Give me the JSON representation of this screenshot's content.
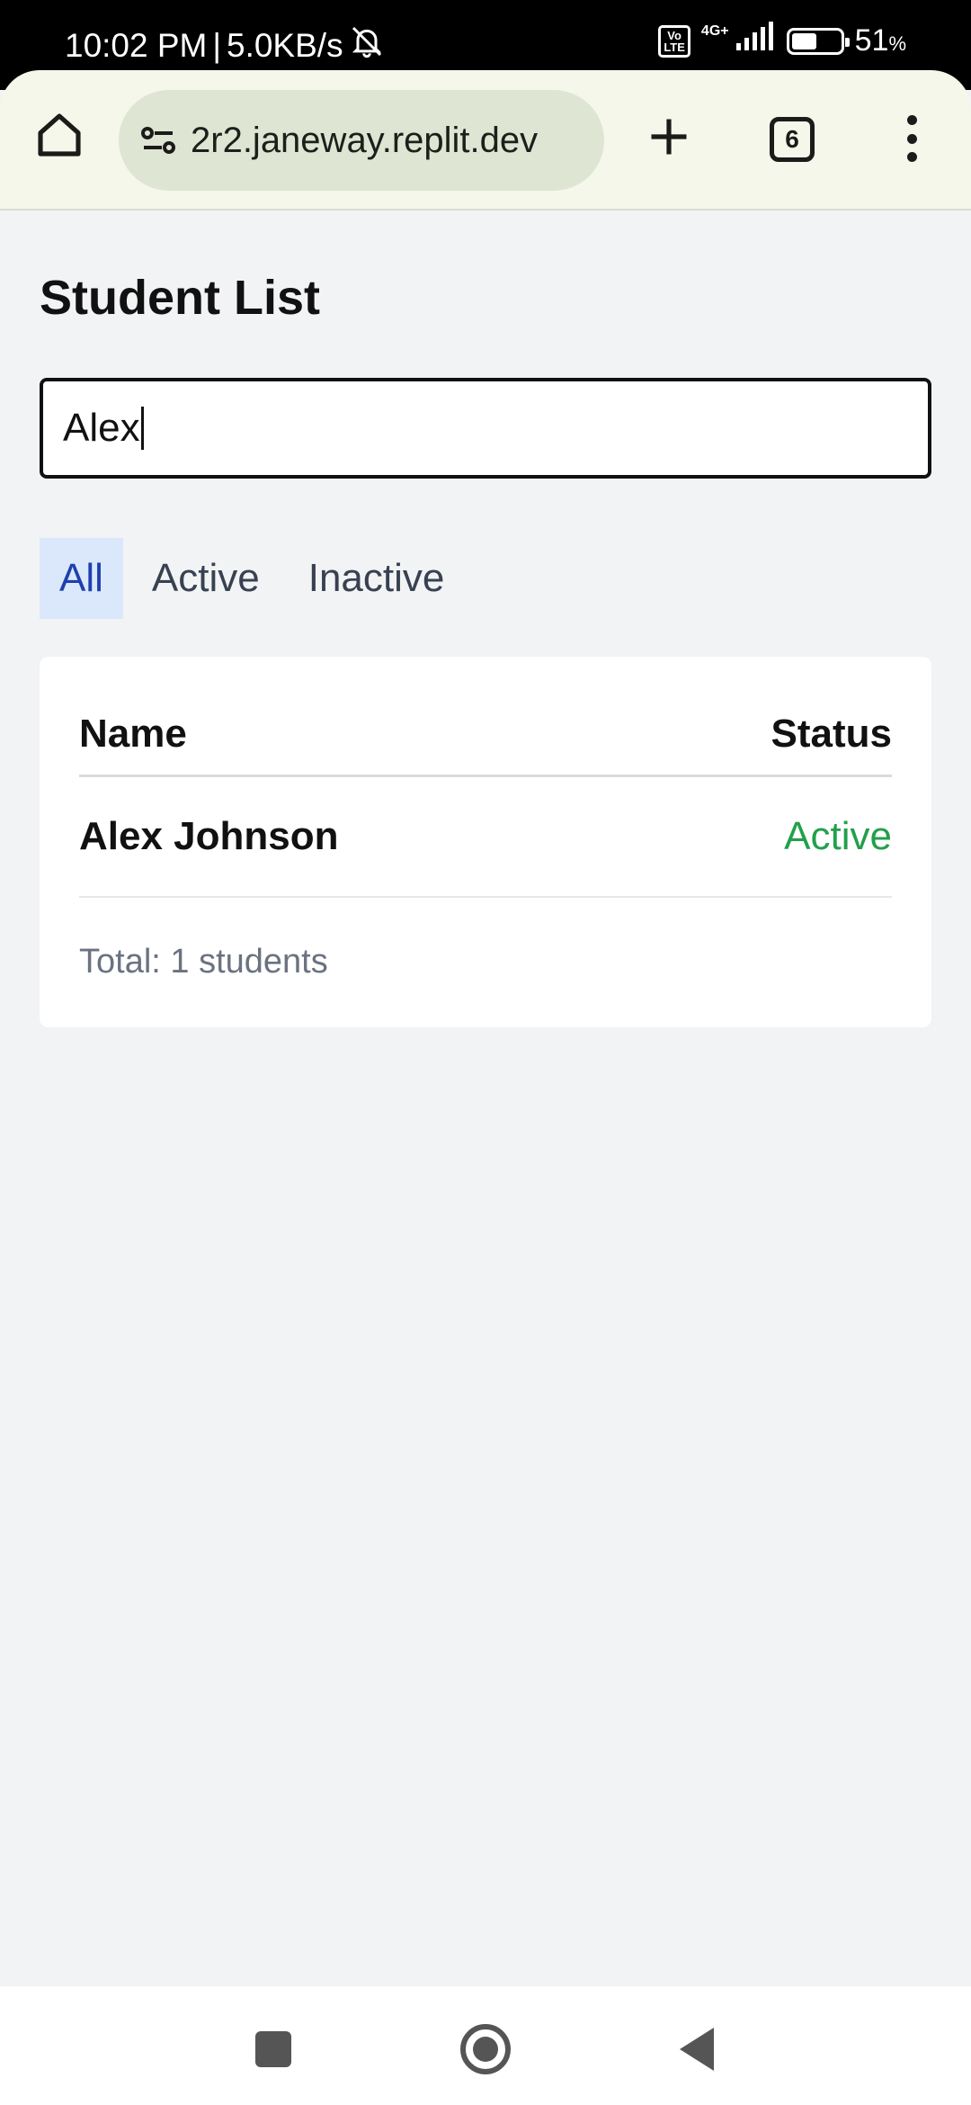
{
  "status_bar": {
    "time": "10:02 PM",
    "speed": "5.0KB/s",
    "volte": "Vo\nLTE",
    "network": "4G+",
    "battery_level": 0.51,
    "battery_percent": "51",
    "battery_unit": "%"
  },
  "browser": {
    "url": "2r2.janeway.replit.dev",
    "tab_count": "6"
  },
  "page": {
    "title": "Student List",
    "search_value": "Alex",
    "filters": [
      {
        "label": "All",
        "selected": true
      },
      {
        "label": "Active",
        "selected": false
      },
      {
        "label": "Inactive",
        "selected": false
      }
    ],
    "table": {
      "headers": {
        "name": "Name",
        "status": "Status"
      },
      "rows": [
        {
          "name": "Alex Johnson",
          "status": "Active"
        }
      ]
    },
    "total": "Total: 1 students"
  },
  "colors": {
    "active_status": "#22a04b",
    "filter_selected_bg": "#dbe8fc",
    "filter_selected_text": "#1e40af"
  }
}
